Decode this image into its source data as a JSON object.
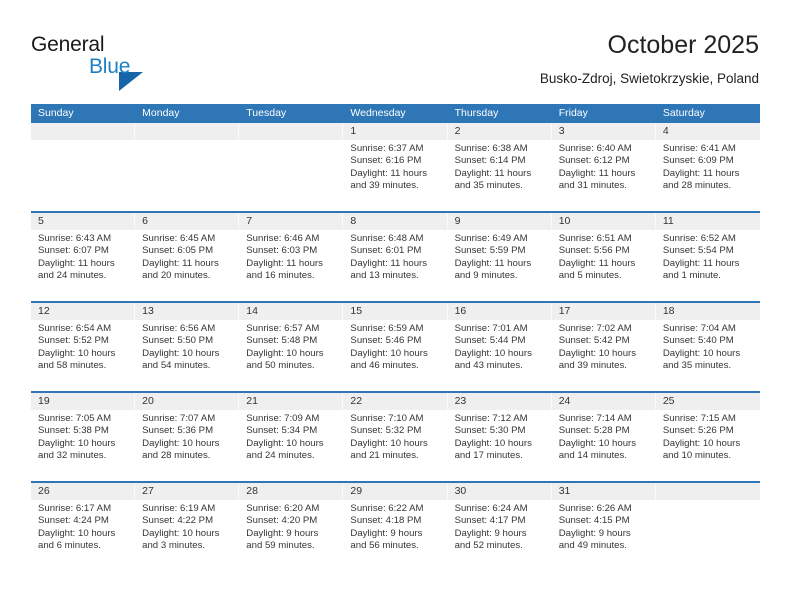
{
  "brand": {
    "name_part1": "General",
    "name_part2": "Blue",
    "accent_color": "#1f7fc4",
    "triangle_color": "#1565a8"
  },
  "header": {
    "title": "October 2025",
    "location": "Busko-Zdroj, Swietokrzyskie, Poland"
  },
  "theme": {
    "header_blue": "#2e76b6",
    "day_band_gray": "#efeff0",
    "text_color": "#363636"
  },
  "weekdays": [
    "Sunday",
    "Monday",
    "Tuesday",
    "Wednesday",
    "Thursday",
    "Friday",
    "Saturday"
  ],
  "weeks": [
    [
      {
        "day": "",
        "empty": true,
        "lines": []
      },
      {
        "day": "",
        "empty": true,
        "lines": []
      },
      {
        "day": "",
        "empty": true,
        "lines": []
      },
      {
        "day": "1",
        "empty": false,
        "lines": [
          "Sunrise: 6:37 AM",
          "Sunset: 6:16 PM",
          "Daylight: 11 hours",
          "and 39 minutes."
        ]
      },
      {
        "day": "2",
        "empty": false,
        "lines": [
          "Sunrise: 6:38 AM",
          "Sunset: 6:14 PM",
          "Daylight: 11 hours",
          "and 35 minutes."
        ]
      },
      {
        "day": "3",
        "empty": false,
        "lines": [
          "Sunrise: 6:40 AM",
          "Sunset: 6:12 PM",
          "Daylight: 11 hours",
          "and 31 minutes."
        ]
      },
      {
        "day": "4",
        "empty": false,
        "lines": [
          "Sunrise: 6:41 AM",
          "Sunset: 6:09 PM",
          "Daylight: 11 hours",
          "and 28 minutes."
        ]
      }
    ],
    [
      {
        "day": "5",
        "empty": false,
        "lines": [
          "Sunrise: 6:43 AM",
          "Sunset: 6:07 PM",
          "Daylight: 11 hours",
          "and 24 minutes."
        ]
      },
      {
        "day": "6",
        "empty": false,
        "lines": [
          "Sunrise: 6:45 AM",
          "Sunset: 6:05 PM",
          "Daylight: 11 hours",
          "and 20 minutes."
        ]
      },
      {
        "day": "7",
        "empty": false,
        "lines": [
          "Sunrise: 6:46 AM",
          "Sunset: 6:03 PM",
          "Daylight: 11 hours",
          "and 16 minutes."
        ]
      },
      {
        "day": "8",
        "empty": false,
        "lines": [
          "Sunrise: 6:48 AM",
          "Sunset: 6:01 PM",
          "Daylight: 11 hours",
          "and 13 minutes."
        ]
      },
      {
        "day": "9",
        "empty": false,
        "lines": [
          "Sunrise: 6:49 AM",
          "Sunset: 5:59 PM",
          "Daylight: 11 hours",
          "and 9 minutes."
        ]
      },
      {
        "day": "10",
        "empty": false,
        "lines": [
          "Sunrise: 6:51 AM",
          "Sunset: 5:56 PM",
          "Daylight: 11 hours",
          "and 5 minutes."
        ]
      },
      {
        "day": "11",
        "empty": false,
        "lines": [
          "Sunrise: 6:52 AM",
          "Sunset: 5:54 PM",
          "Daylight: 11 hours",
          "and 1 minute."
        ]
      }
    ],
    [
      {
        "day": "12",
        "empty": false,
        "lines": [
          "Sunrise: 6:54 AM",
          "Sunset: 5:52 PM",
          "Daylight: 10 hours",
          "and 58 minutes."
        ]
      },
      {
        "day": "13",
        "empty": false,
        "lines": [
          "Sunrise: 6:56 AM",
          "Sunset: 5:50 PM",
          "Daylight: 10 hours",
          "and 54 minutes."
        ]
      },
      {
        "day": "14",
        "empty": false,
        "lines": [
          "Sunrise: 6:57 AM",
          "Sunset: 5:48 PM",
          "Daylight: 10 hours",
          "and 50 minutes."
        ]
      },
      {
        "day": "15",
        "empty": false,
        "lines": [
          "Sunrise: 6:59 AM",
          "Sunset: 5:46 PM",
          "Daylight: 10 hours",
          "and 46 minutes."
        ]
      },
      {
        "day": "16",
        "empty": false,
        "lines": [
          "Sunrise: 7:01 AM",
          "Sunset: 5:44 PM",
          "Daylight: 10 hours",
          "and 43 minutes."
        ]
      },
      {
        "day": "17",
        "empty": false,
        "lines": [
          "Sunrise: 7:02 AM",
          "Sunset: 5:42 PM",
          "Daylight: 10 hours",
          "and 39 minutes."
        ]
      },
      {
        "day": "18",
        "empty": false,
        "lines": [
          "Sunrise: 7:04 AM",
          "Sunset: 5:40 PM",
          "Daylight: 10 hours",
          "and 35 minutes."
        ]
      }
    ],
    [
      {
        "day": "19",
        "empty": false,
        "lines": [
          "Sunrise: 7:05 AM",
          "Sunset: 5:38 PM",
          "Daylight: 10 hours",
          "and 32 minutes."
        ]
      },
      {
        "day": "20",
        "empty": false,
        "lines": [
          "Sunrise: 7:07 AM",
          "Sunset: 5:36 PM",
          "Daylight: 10 hours",
          "and 28 minutes."
        ]
      },
      {
        "day": "21",
        "empty": false,
        "lines": [
          "Sunrise: 7:09 AM",
          "Sunset: 5:34 PM",
          "Daylight: 10 hours",
          "and 24 minutes."
        ]
      },
      {
        "day": "22",
        "empty": false,
        "lines": [
          "Sunrise: 7:10 AM",
          "Sunset: 5:32 PM",
          "Daylight: 10 hours",
          "and 21 minutes."
        ]
      },
      {
        "day": "23",
        "empty": false,
        "lines": [
          "Sunrise: 7:12 AM",
          "Sunset: 5:30 PM",
          "Daylight: 10 hours",
          "and 17 minutes."
        ]
      },
      {
        "day": "24",
        "empty": false,
        "lines": [
          "Sunrise: 7:14 AM",
          "Sunset: 5:28 PM",
          "Daylight: 10 hours",
          "and 14 minutes."
        ]
      },
      {
        "day": "25",
        "empty": false,
        "lines": [
          "Sunrise: 7:15 AM",
          "Sunset: 5:26 PM",
          "Daylight: 10 hours",
          "and 10 minutes."
        ]
      }
    ],
    [
      {
        "day": "26",
        "empty": false,
        "lines": [
          "Sunrise: 6:17 AM",
          "Sunset: 4:24 PM",
          "Daylight: 10 hours",
          "and 6 minutes."
        ]
      },
      {
        "day": "27",
        "empty": false,
        "lines": [
          "Sunrise: 6:19 AM",
          "Sunset: 4:22 PM",
          "Daylight: 10 hours",
          "and 3 minutes."
        ]
      },
      {
        "day": "28",
        "empty": false,
        "lines": [
          "Sunrise: 6:20 AM",
          "Sunset: 4:20 PM",
          "Daylight: 9 hours",
          "and 59 minutes."
        ]
      },
      {
        "day": "29",
        "empty": false,
        "lines": [
          "Sunrise: 6:22 AM",
          "Sunset: 4:18 PM",
          "Daylight: 9 hours",
          "and 56 minutes."
        ]
      },
      {
        "day": "30",
        "empty": false,
        "lines": [
          "Sunrise: 6:24 AM",
          "Sunset: 4:17 PM",
          "Daylight: 9 hours",
          "and 52 minutes."
        ]
      },
      {
        "day": "31",
        "empty": false,
        "lines": [
          "Sunrise: 6:26 AM",
          "Sunset: 4:15 PM",
          "Daylight: 9 hours",
          "and 49 minutes."
        ]
      },
      {
        "day": "",
        "empty": true,
        "lines": []
      }
    ]
  ]
}
